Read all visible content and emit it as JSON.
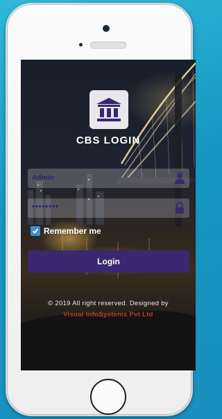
{
  "app": {
    "title": "CBS LOGIN",
    "logo_icon": "bank-building-icon"
  },
  "form": {
    "username_value": "Admin",
    "password_value": "••••••••",
    "username_icon": "user-icon",
    "password_icon": "lock-icon",
    "remember_label": "Remember me",
    "remember_checked": true,
    "login_label": "Login"
  },
  "footer": {
    "copyright": "© 2019 All right reserved. Designed by",
    "company": "Visual InfoSystems Pvt Ltd"
  },
  "colors": {
    "login_button": "#3a2870",
    "field_text": "#2a1f6e",
    "checkbox": "#3b8fd4",
    "company_text": "#c8352a"
  }
}
